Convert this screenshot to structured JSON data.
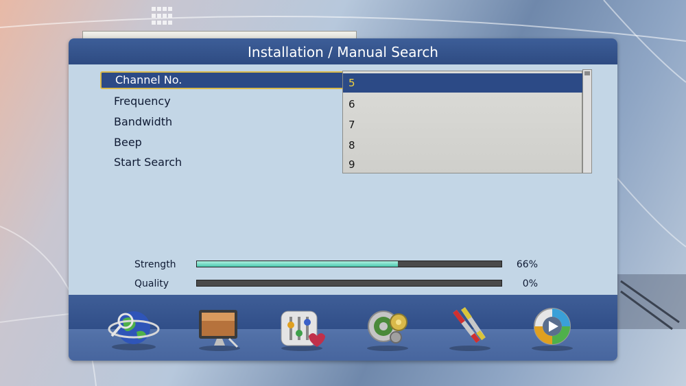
{
  "header": {
    "title": "Installation / Manual Search"
  },
  "menu": {
    "items": [
      {
        "label": "Channel No.",
        "selected": true
      },
      {
        "label": "Frequency",
        "selected": false
      },
      {
        "label": "Bandwidth",
        "selected": false
      },
      {
        "label": "Beep",
        "selected": false
      },
      {
        "label": "Start Search",
        "selected": false
      }
    ]
  },
  "dropdown": {
    "options": [
      "5",
      "6",
      "7",
      "8",
      "9"
    ],
    "selected": "5"
  },
  "signal": {
    "strength": {
      "label": "Strength",
      "value": "66%",
      "fraction": 0.66
    },
    "quality": {
      "label": "Quality",
      "value": "0%",
      "fraction": 0.0
    }
  },
  "dock": {
    "icons": [
      "globe-icon",
      "tv-icon",
      "equalizer-icon",
      "gear-icon",
      "cable-icon",
      "play-icon"
    ]
  },
  "colors": {
    "accent": "#2c4a86",
    "highlight_border": "#d9b94a",
    "selected_value": "#f4d23c",
    "signal_fill": "#4cc9b0"
  }
}
